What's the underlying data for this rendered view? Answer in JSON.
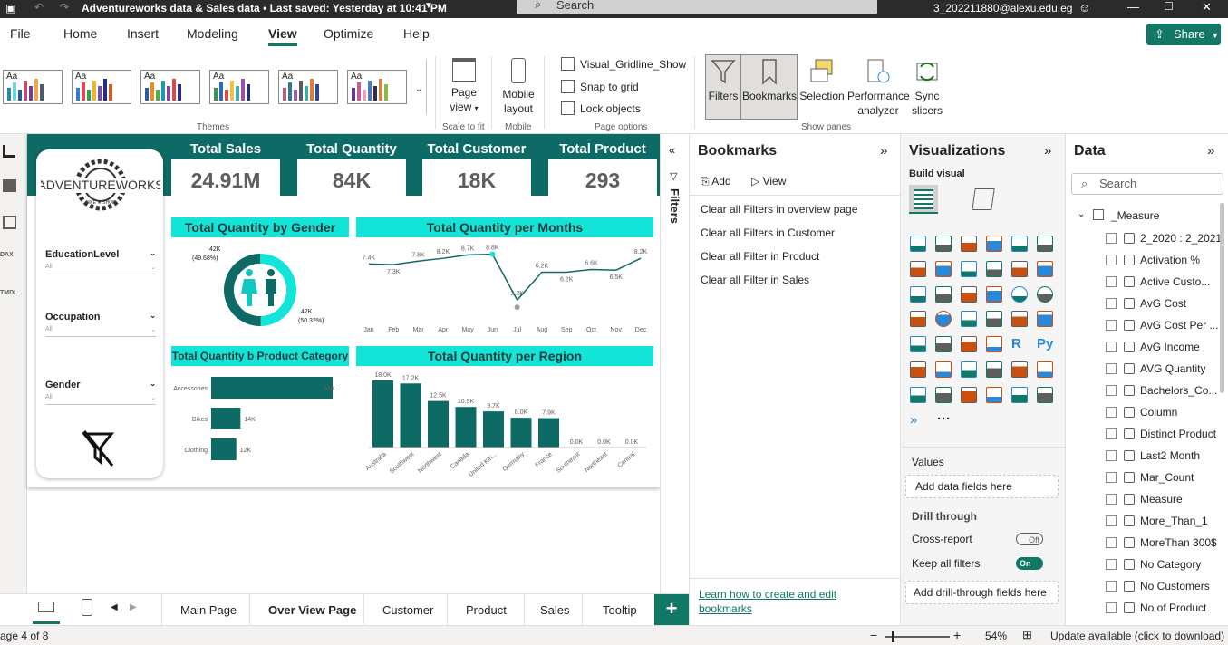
{
  "titlebar": {
    "title": "Adventureworks data & Sales data • Last saved: Yesterday at 10:41 PM",
    "search": "Search",
    "account": "3_202211880@alexu.edu.eg"
  },
  "menu": {
    "items": [
      "File",
      "Home",
      "Insert",
      "Modeling",
      "View",
      "Optimize",
      "Help"
    ],
    "active": "View",
    "share": "Share"
  },
  "ribbon": {
    "themes_label": "Themes",
    "page_view_1": "Page",
    "page_view_2": "view",
    "scale_label": "Scale to fit",
    "mobile_1": "Mobile",
    "mobile_2": "layout",
    "mobile_group": "Mobile",
    "gridlines": "Visual_Gridline_Show",
    "snap": "Snap to grid",
    "lock": "Lock objects",
    "page_options": "Page options",
    "filters": "Filters",
    "bookmarks": "Bookmarks",
    "selection": "Selection",
    "perf_1": "Performance",
    "perf_2": "analyzer",
    "sync_1": "Sync",
    "sync_2": "slicers",
    "show_panes": "Show panes"
  },
  "theme_colors": [
    [
      "#1f8f9a",
      "#6fd3dd",
      "#2c5d8f",
      "#b94c70",
      "#7b3a8f",
      "#f0a84b",
      "#4a5b6a"
    ],
    [
      "#2e7dd6",
      "#e8454c",
      "#35a04a",
      "#f0b52e",
      "#7a4ab8",
      "#222d88",
      "#cf5c2b"
    ],
    [
      "#2a5caa",
      "#f08a24",
      "#4cae4f",
      "#1b9ba8",
      "#8d3f9a",
      "#d54a4a",
      "#2a2a80"
    ],
    [
      "#3b8f5a",
      "#2a6fa8",
      "#d94a4a",
      "#f2c043",
      "#3ab0c8",
      "#a64aa8",
      "#1f2f6e"
    ],
    [
      "#b35c7a",
      "#2f7a8e",
      "#9a5ca8",
      "#5c5c5c",
      "#3ab09e",
      "#e07b39",
      "#2f4a8e"
    ],
    [
      "#5b3a8f",
      "#c45c96",
      "#e8a0b8",
      "#4a7ab8",
      "#2f2f4a",
      "#d88040",
      "#8fb84a"
    ]
  ],
  "report": {
    "logo_text": "ADVENTUREWORKS",
    "logo_sub": "BIKE ★ SHOP",
    "slicers": [
      {
        "label": "EducationLevel",
        "value": "All"
      },
      {
        "label": "Occupation",
        "value": "All"
      },
      {
        "label": "Gender",
        "value": "All"
      }
    ],
    "kpis": [
      {
        "title": "Total Sales",
        "value": "24.91M"
      },
      {
        "title": "Total Quantity",
        "value": "84K"
      },
      {
        "title": "Total Customer",
        "value": "18K"
      },
      {
        "title": "Total Product",
        "value": "293"
      }
    ],
    "gender_title": "Total Quantity by Gender",
    "gender_label_1a": "42K",
    "gender_label_1b": "(49.68%)",
    "gender_label_2a": "42K",
    "gender_label_2b": "(50.32%)",
    "months_title": "Total Quantity per Months",
    "category_title": "Total Quantity b Product Category",
    "region_title": "Total Quantity per Region"
  },
  "chart_data": [
    {
      "type": "pie",
      "title": "Total Quantity by Gender",
      "categories": [
        "F",
        "M"
      ],
      "values": [
        49.68,
        50.32
      ]
    },
    {
      "type": "line",
      "title": "Total Quantity per Months",
      "x": [
        "Jan",
        "Feb",
        "Mar",
        "Apr",
        "May",
        "Jun",
        "Jul",
        "Aug",
        "Sep",
        "Oct",
        "Nov",
        "Dec"
      ],
      "values": [
        7.4,
        7.3,
        7.8,
        8.2,
        8.7,
        8.8,
        2.2,
        6.2,
        6.2,
        6.6,
        6.5,
        8.2
      ],
      "labels": [
        "7.4K",
        "7.3K",
        "7.8K",
        "8.2K",
        "8.7K",
        "8.8K",
        "2.2K",
        "6.2K",
        "6.2K",
        "6.6K",
        "6.5K",
        "8.2K"
      ],
      "ylim": [
        0,
        9.4
      ]
    },
    {
      "type": "bar",
      "title": "Total Quantity b Product Category",
      "categories": [
        "Accessories",
        "Bikes",
        "Clothing"
      ],
      "values": [
        58,
        14,
        12
      ],
      "labels": [
        "58K",
        "14K",
        "12K"
      ],
      "xlim": [
        0,
        58
      ]
    },
    {
      "type": "bar",
      "title": "Total Quantity per Region",
      "categories": [
        "Australia",
        "Southwest",
        "Northwest",
        "Canada",
        "United Kin...",
        "Germany",
        "France",
        "Southeast",
        "Northeast",
        "Central"
      ],
      "values": [
        18.0,
        17.2,
        12.5,
        10.9,
        9.7,
        8.0,
        7.9,
        0.0,
        0.0,
        0.0
      ],
      "labels": [
        "18.0K",
        "17.2K",
        "12.5K",
        "10.9K",
        "9.7K",
        "8.0K",
        "7.9K",
        "0.0K",
        "0.0K",
        "0.0K"
      ],
      "ylim": [
        0,
        18.0
      ]
    }
  ],
  "filters_strip": "Filters",
  "bookmarks": {
    "title": "Bookmarks",
    "add": "Add",
    "view": "View",
    "items": [
      "Clear all Filters in overview page",
      "Clear all Filters in Customer",
      "Clear all Filter in Product",
      "Clear all Filter in Sales"
    ],
    "learn_1": "Learn how to create and edit",
    "learn_2": "bookmarks"
  },
  "viz": {
    "title": "Visualizations",
    "build": "Build visual",
    "values": "Values",
    "values_zone": "Add data fields here",
    "drill": "Drill through",
    "cross": "Cross-report",
    "cross_state": "Off",
    "keep": "Keep all filters",
    "keep_state": "On",
    "drill_zone": "Add drill-through fields here",
    "r": "R",
    "py": "Py",
    "more": "···"
  },
  "data": {
    "title": "Data",
    "search": "Search",
    "table": "_Measure",
    "fields": [
      "2_2020 : 2_2021",
      "Activation %",
      "Active Custo...",
      "AvG Cost",
      "AvG Cost Per ...",
      "AvG Income",
      "AVG Quantity",
      "Bachelors_Co...",
      "Column",
      "Distinct Product",
      "Last2 Month",
      "Mar_Count",
      "Measure",
      "More_Than_1",
      "MoreThan 300$",
      "No Category",
      "No Customers",
      "No of Product"
    ]
  },
  "tabs": {
    "items": [
      "Main Page",
      "Over View Page",
      "Customer",
      "Product",
      "Sales",
      "Tooltip"
    ],
    "active": "Over View Page"
  },
  "status": {
    "page": "age 4 of 8",
    "zoom": "54%",
    "update": "Update available (click to download)"
  }
}
